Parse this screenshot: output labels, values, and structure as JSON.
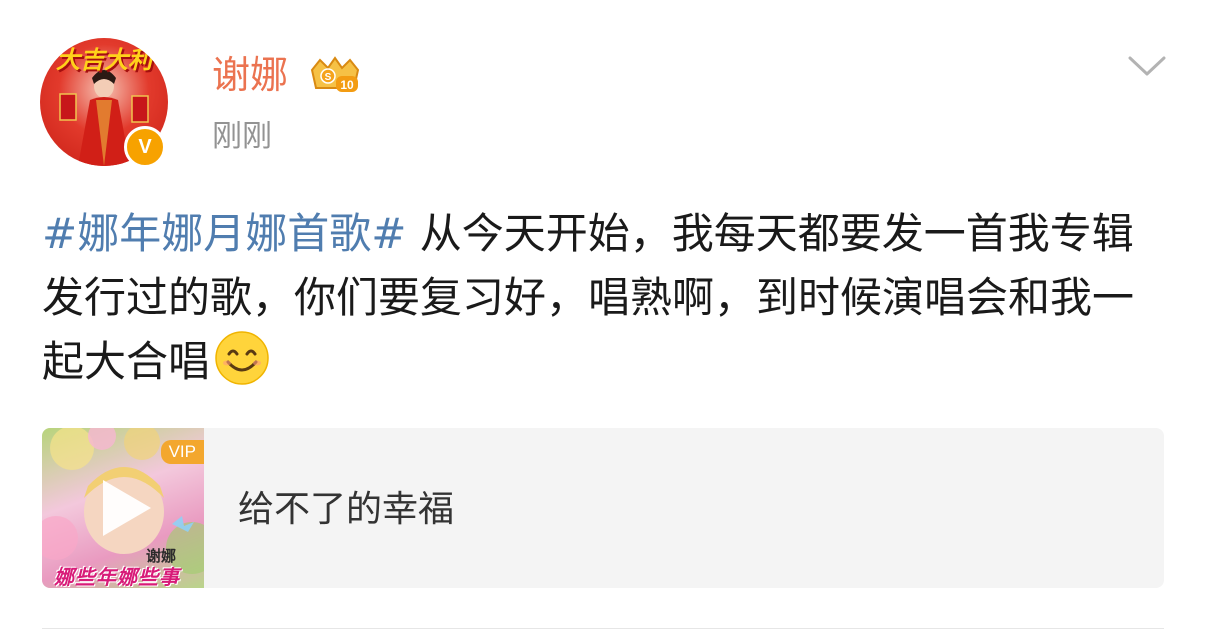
{
  "post": {
    "author": {
      "name": "谢娜",
      "avatar_banner_text": "大吉大利",
      "verified_badge_text": "V",
      "member_level": "10"
    },
    "timestamp": "刚刚",
    "text": {
      "hashtag": "#娜年娜月娜首歌#",
      "body": " 从今天开始，我每天都要发一首我专辑发行过的歌，你们要复习好，唱熟啊，到时候演唱会和我一起大合唱",
      "emoji": "smile-emoji"
    },
    "music_card": {
      "vip_tag": "VIP",
      "cover_artist": "谢娜",
      "cover_album": "娜些年娜些事",
      "song_title": "给不了的幸福",
      "icon": "play-icon"
    },
    "actions": {
      "more_icon": "chevron-down-icon"
    }
  },
  "colors": {
    "username": "#eb7350",
    "hashtag": "#507daf",
    "timestamp": "#939393",
    "card_bg": "#f4f4f4",
    "verify_badge": "#f7a200"
  }
}
